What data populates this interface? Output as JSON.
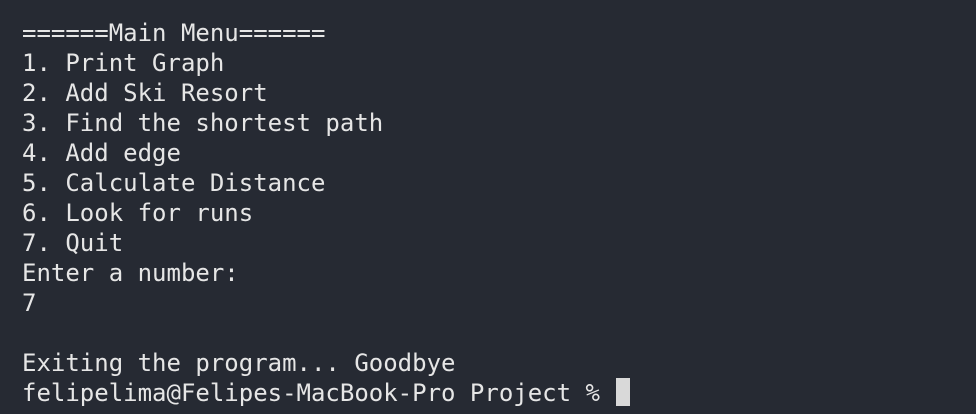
{
  "terminal": {
    "background": "#262a33",
    "text_color": "#e6e6e6",
    "menu_header": "======Main Menu======",
    "menu_items": [
      "1. Print Graph",
      "2. Add Ski Resort",
      "3. Find the shortest path",
      "4. Add edge",
      "5. Calculate Distance",
      "6. Look for runs",
      "7. Quit"
    ],
    "input_prompt": "Enter a number:",
    "input_value": "7",
    "exit_message": "Exiting the program... Goodbye",
    "shell_prompt": "felipelima@Felipes-MacBook-Pro Project % "
  }
}
